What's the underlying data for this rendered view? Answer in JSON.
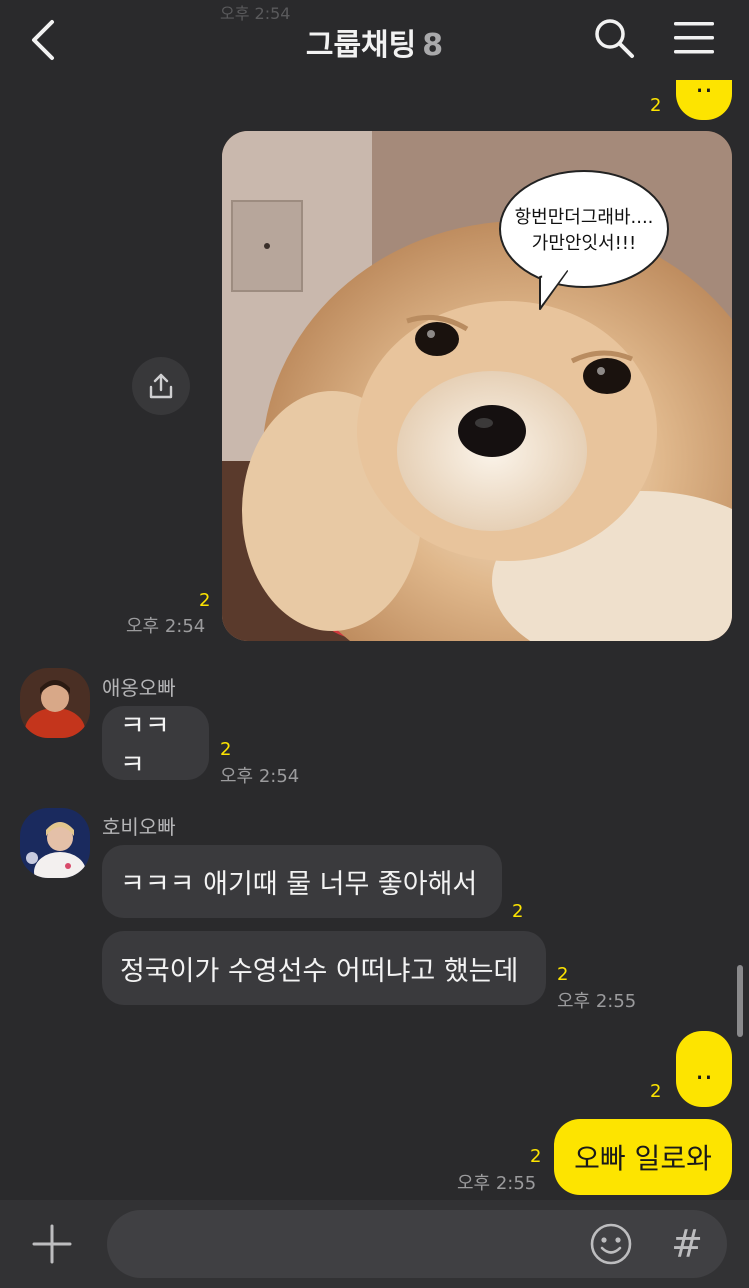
{
  "header": {
    "title": "그룹채팅",
    "member_count": "8",
    "ghost_time": "오후 2:54"
  },
  "messages": {
    "m1": {
      "text": "..",
      "unread": "2"
    },
    "photo": {
      "speech_line1": "항번만더그래바....",
      "speech_line2": "가만안잇서!!!",
      "unread": "2",
      "time": "오후 2:54"
    },
    "aeong": {
      "sender": "애옹오빠",
      "text": "ㅋㅋㅋ",
      "unread": "2",
      "time": "오후 2:54"
    },
    "hobi": {
      "sender": "호비오빠",
      "text1": "ㅋㅋㅋ 애기때 물 너무 좋아해서",
      "unread1": "2",
      "text2": "정국이가 수영선수 어떠냐고 했는데",
      "unread2": "2",
      "time": "오후 2:55"
    },
    "m2": {
      "text": "..",
      "unread": "2"
    },
    "m3": {
      "text": "오빠 일로와",
      "unread": "2",
      "time": "오후 2:55"
    }
  },
  "input": {
    "placeholder": "",
    "hash_label": "#"
  },
  "colors": {
    "accent": "#fde400",
    "background": "#2a2a2c",
    "bubble_other": "#3a3a3d"
  }
}
